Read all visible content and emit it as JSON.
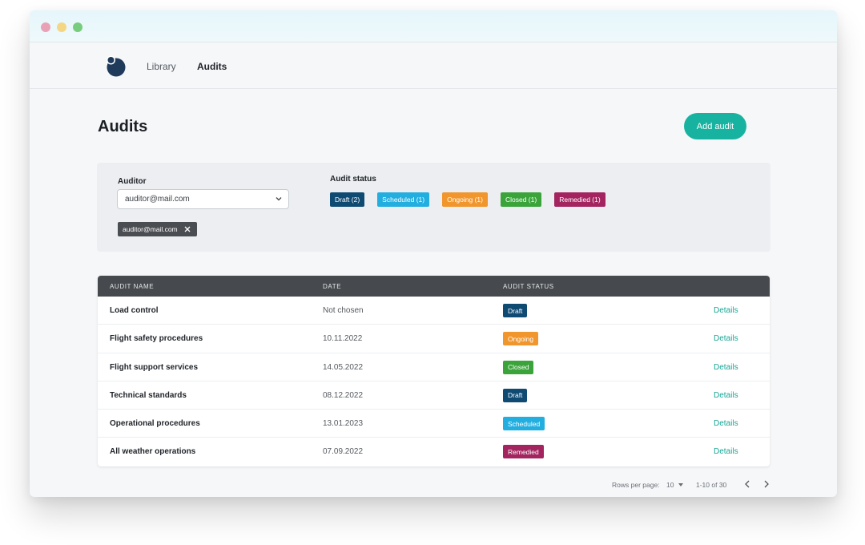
{
  "nav": {
    "links": [
      "Library",
      "Audits"
    ],
    "active": "Audits"
  },
  "page": {
    "title": "Audits",
    "add_button": "Add audit"
  },
  "filters": {
    "auditor_label": "Auditor",
    "auditor_value": "auditor@mail.com",
    "chip_value": "auditor@mail.com",
    "status_label": "Audit status",
    "status_tags": [
      {
        "label": "Draft (2)",
        "color": "#0f4a73"
      },
      {
        "label": "Scheduled (1)",
        "color": "#23aee0"
      },
      {
        "label": "Ongoing (1)",
        "color": "#f0962d"
      },
      {
        "label": "Closed (1)",
        "color": "#3aa43a"
      },
      {
        "label": "Remedied (1)",
        "color": "#a3245f"
      }
    ]
  },
  "table": {
    "headers": [
      "AUDIT NAME",
      "DATE",
      "AUDIT STATUS"
    ],
    "rows": [
      {
        "name": "Load control",
        "date": "Not chosen",
        "status": "Draft",
        "status_color": "#0f4a73",
        "action": "Details"
      },
      {
        "name": "Flight safety procedures",
        "date": "10.11.2022",
        "status": "Ongoing",
        "status_color": "#f0962d",
        "action": "Details"
      },
      {
        "name": "Flight support services",
        "date": "14.05.2022",
        "status": "Closed",
        "status_color": "#3aa43a",
        "action": "Details"
      },
      {
        "name": "Technical standards",
        "date": "08.12.2022",
        "status": "Draft",
        "status_color": "#0f4a73",
        "action": "Details"
      },
      {
        "name": "Operational procedures",
        "date": "13.01.2023",
        "status": "Scheduled",
        "status_color": "#23aee0",
        "action": "Details"
      },
      {
        "name": "All weather operations",
        "date": "07.09.2022",
        "status": "Remedied",
        "status_color": "#a3245f",
        "action": "Details"
      }
    ]
  },
  "pagination": {
    "rows_per_page_label": "Rows per page:",
    "rows_per_page_value": "10",
    "range": "1-10 of 30"
  },
  "colors": {
    "accent": "#18b3a0",
    "header_bg": "#46494d"
  },
  "icons": [
    "logo-icon",
    "chevron-down-icon",
    "close-icon",
    "chevron-left-icon",
    "chevron-right-icon"
  ]
}
